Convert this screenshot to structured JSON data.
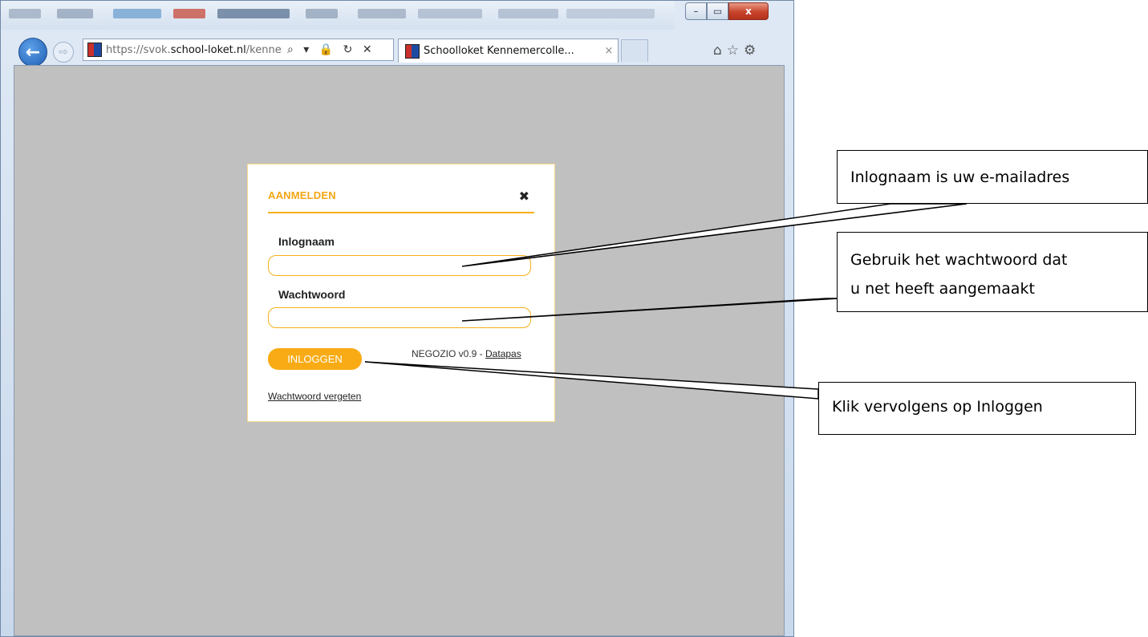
{
  "browser": {
    "url_prefix": "https://svok.",
    "url_domain": "school-loket.nl",
    "url_path": "/kennemer",
    "address_icons": "⌕ ▾ 🔒 ↻ ✕",
    "tab_title": "Schoolloket Kennemercolle...",
    "tab_close": "×",
    "window_controls": {
      "minimize": "–",
      "maximize": "▭",
      "close": "x"
    },
    "back_glyph": "←",
    "forward_glyph": "⇨",
    "tool_icons": "⌂☆⚙"
  },
  "modal": {
    "title": "AANMELDEN",
    "close": "✖",
    "username_label": "Inlognaam",
    "username_value": "",
    "password_label": "Wachtwoord",
    "password_value": "",
    "login_button": "INLOGGEN",
    "version_text": "NEGOZIO v0.9 - ",
    "version_link": "Datapas",
    "forgot_link": "Wachtwoord vergeten"
  },
  "callouts": {
    "username": "Inlognaam is uw e-mailadres",
    "password_line1": "Gebruik het wachtwoord dat",
    "password_line2": "u net heeft aangemaakt",
    "login": "Klik vervolgens op Inloggen"
  },
  "colors": {
    "accent": "#f5b01a",
    "button": "#f9ab15",
    "page_bg": "#c0c0c0"
  }
}
